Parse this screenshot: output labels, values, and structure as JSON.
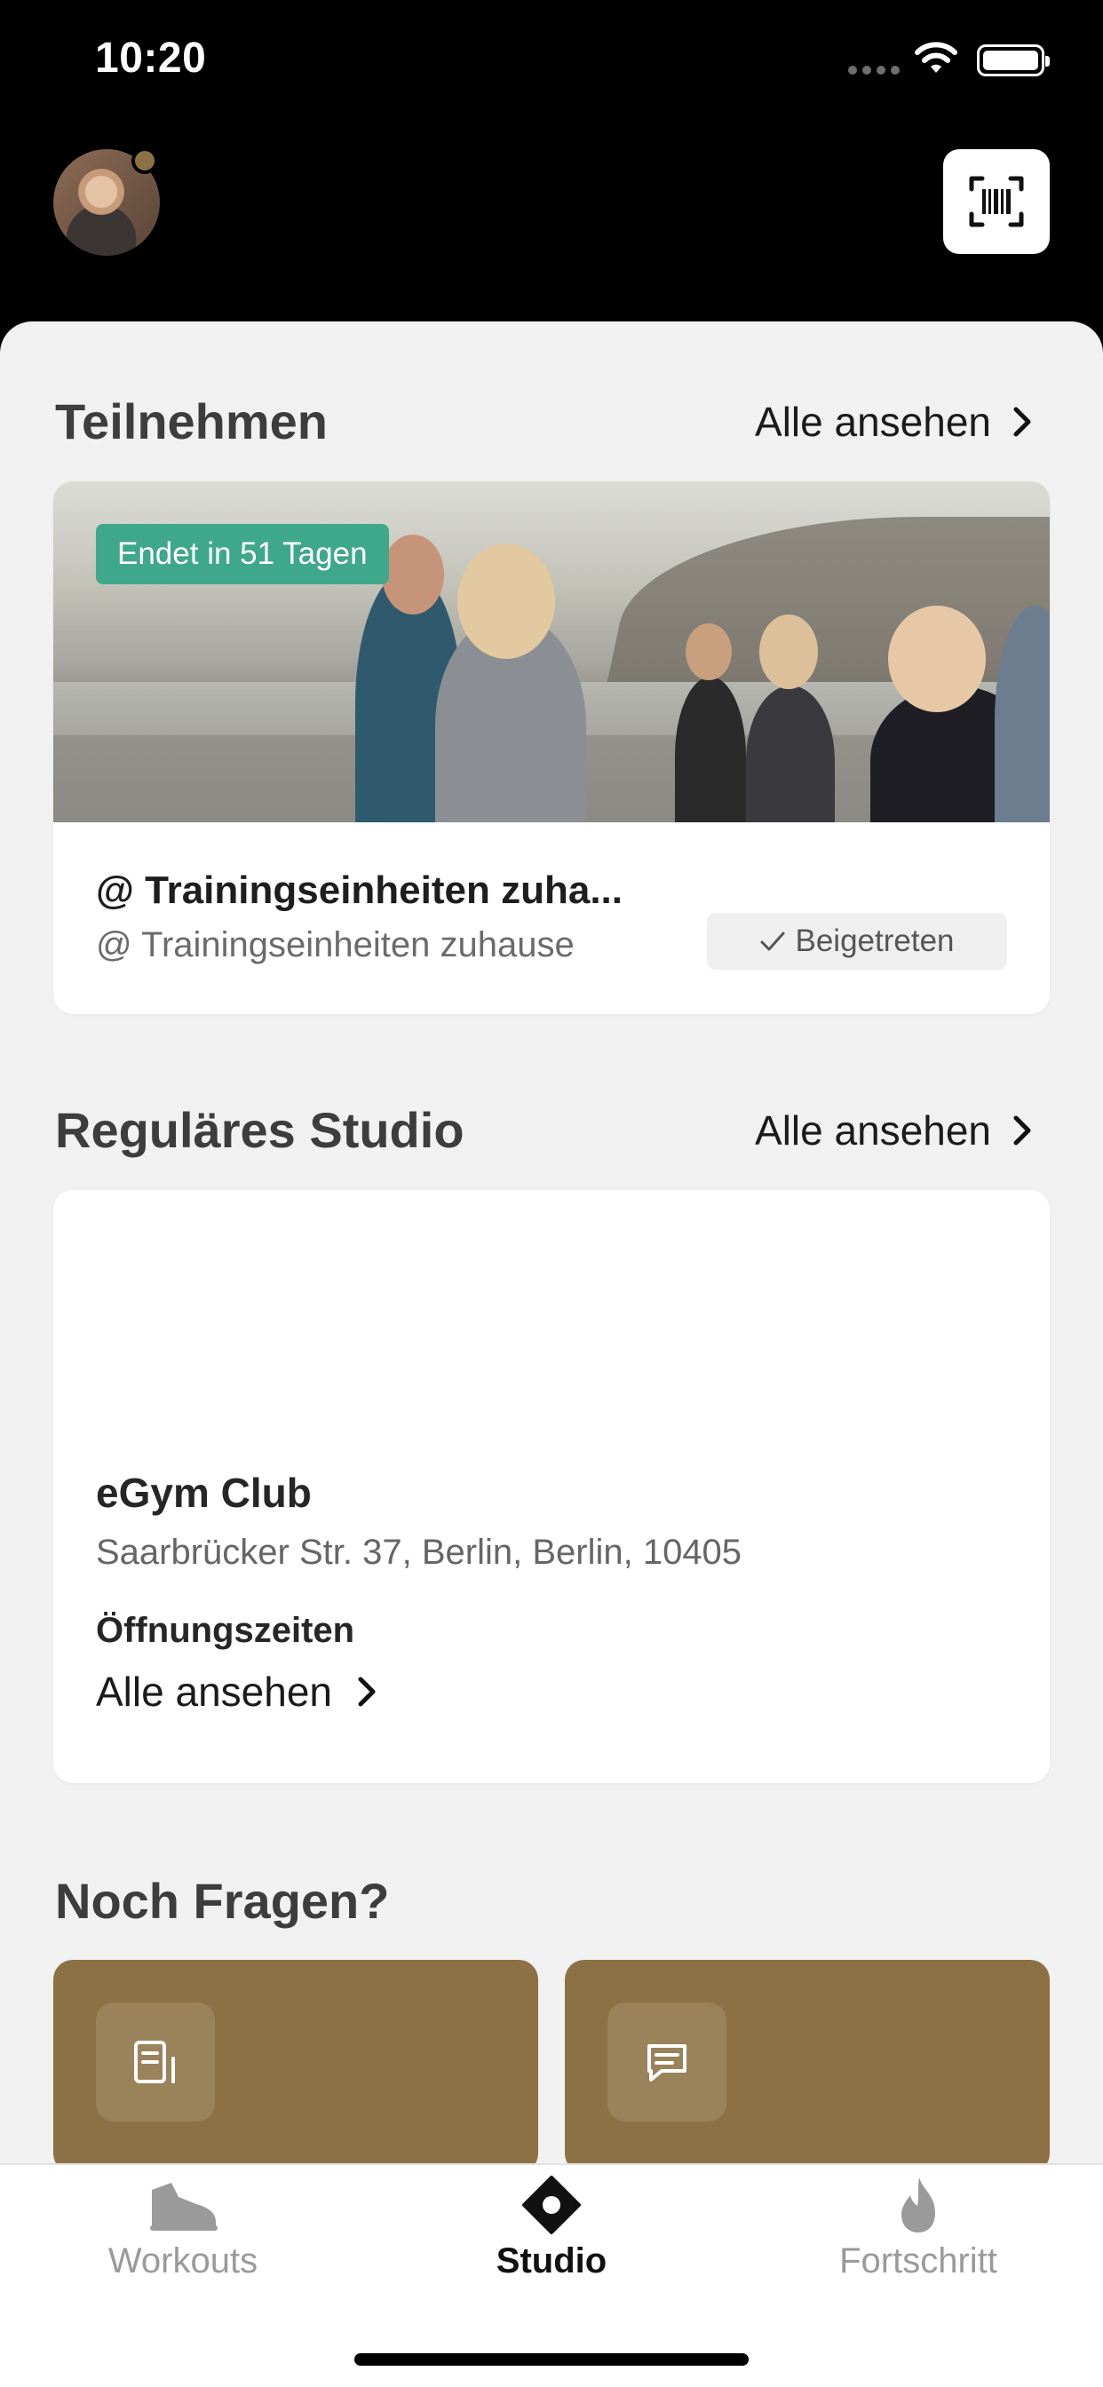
{
  "status_bar": {
    "time": "10:20"
  },
  "header": {
    "avatar_icon": "user-avatar",
    "scan_icon": "barcode-scan-icon"
  },
  "sections": {
    "participate": {
      "title": "Teilnehmen",
      "see_all": "Alle ansehen",
      "challenge": {
        "badge": "Endet in 51 Tagen",
        "title": "@ Trainingseinheiten zuha...",
        "subtitle": "@ Trainingseinheiten zuhause",
        "joined_label": "Beigetreten"
      }
    },
    "studio": {
      "title": "Reguläres Studio",
      "see_all": "Alle ansehen",
      "gym": {
        "name": "eGym Club",
        "address": "Saarbrücker Str. 37, Berlin, Berlin, 10405",
        "hours_label": "Öffnungszeiten",
        "hours_link": "Alle ansehen"
      }
    },
    "questions": {
      "title": "Noch Fragen?",
      "cards": [
        {
          "icon": "document-icon"
        },
        {
          "icon": "chat-icon"
        }
      ]
    }
  },
  "tabs": [
    {
      "label": "Workouts",
      "icon": "shoe-icon",
      "active": false
    },
    {
      "label": "Studio",
      "icon": "studio-diamond-icon",
      "active": true
    },
    {
      "label": "Fortschritt",
      "icon": "flame-icon",
      "active": false
    }
  ],
  "colors": {
    "accent_gold": "#8c7145",
    "badge_green": "#3fa88a",
    "inactive_tab": "#9a9a9a",
    "active_tab": "#111111"
  }
}
